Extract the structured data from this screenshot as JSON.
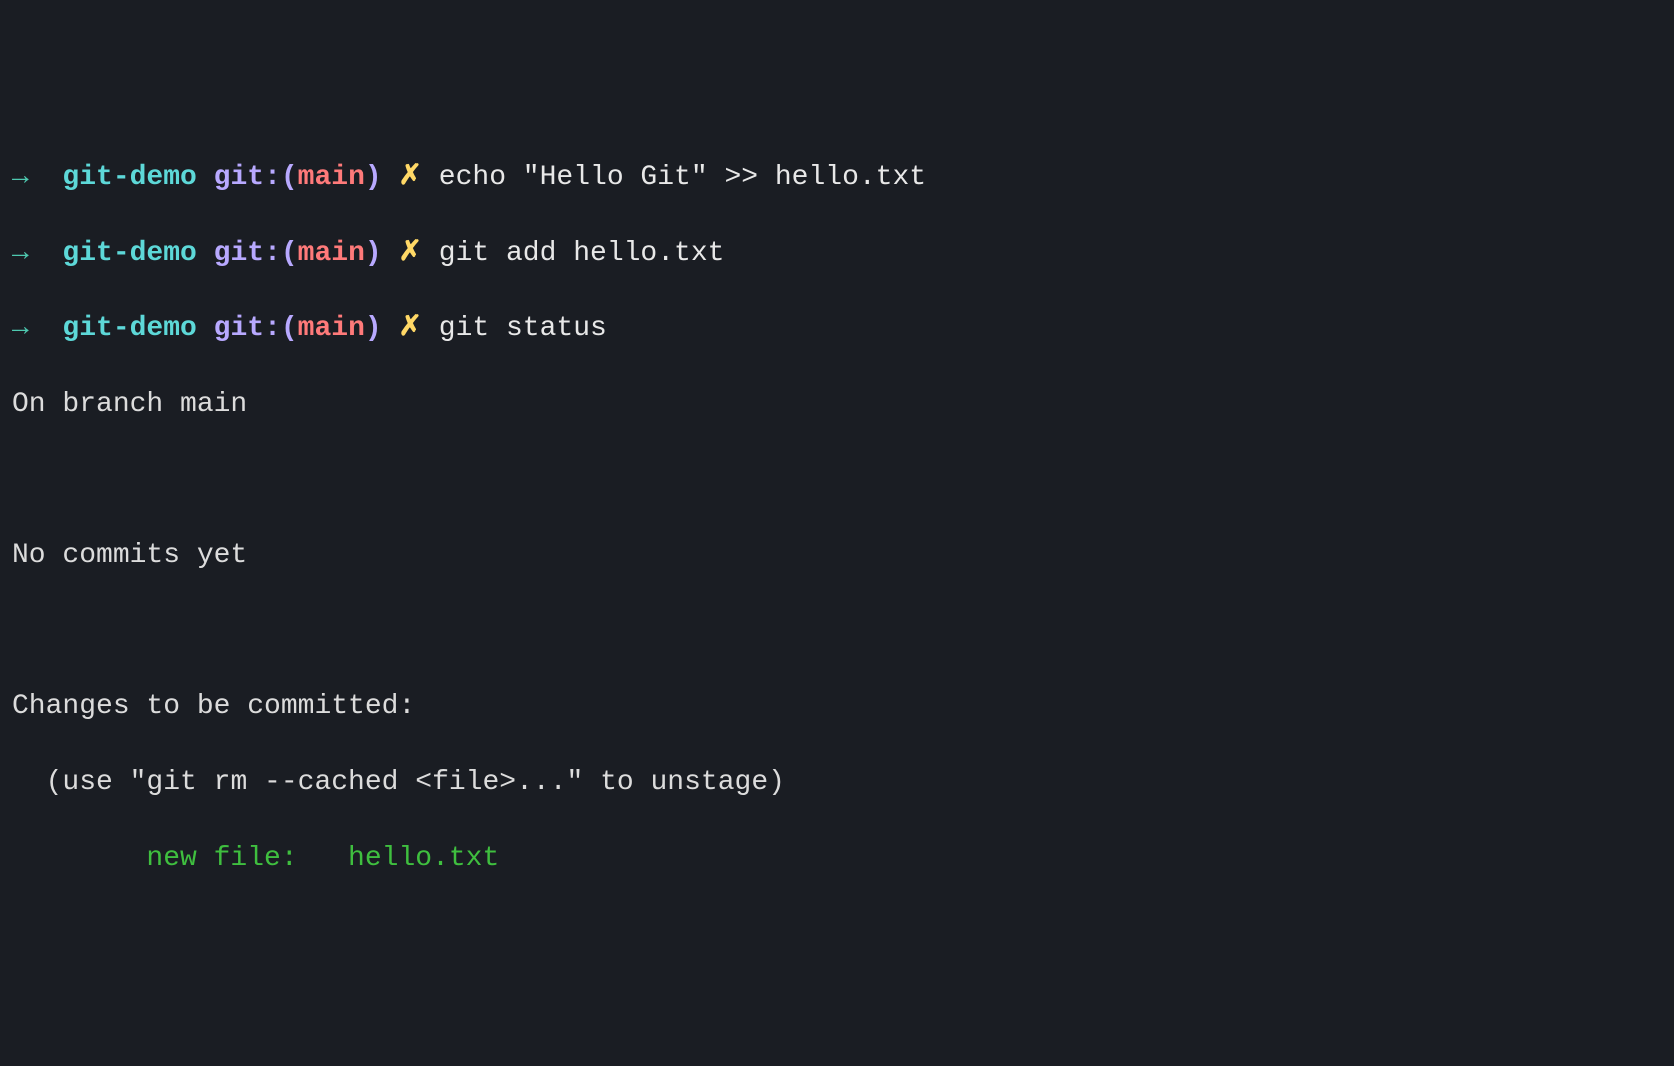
{
  "prompt": {
    "arrow": "→",
    "dir": "git-demo",
    "git_prefix": "git:(",
    "branch": "main",
    "git_suffix": ")",
    "dirty": "✗"
  },
  "commands": [
    {
      "text": "echo \"Hello Git\" >> hello.txt"
    },
    {
      "text": "git add hello.txt"
    },
    {
      "text": "git status"
    }
  ],
  "output": {
    "branch_line": "On branch main",
    "blank": "",
    "no_commits": "No commits yet",
    "changes_header": "Changes to be committed:",
    "unstage_hint": "(use \"git rm --cached <file>...\" to unstage)",
    "staged_file": "new file:   hello.txt"
  },
  "colors": {
    "bg": "#1a1d23",
    "arrow": "#4ec9b0",
    "dir": "#5dd8d8",
    "gitlabel": "#b8a9ff",
    "branch": "#ff7a7a",
    "dirty": "#ffd866",
    "text": "#e8e8e8",
    "green": "#3fbf3f"
  }
}
